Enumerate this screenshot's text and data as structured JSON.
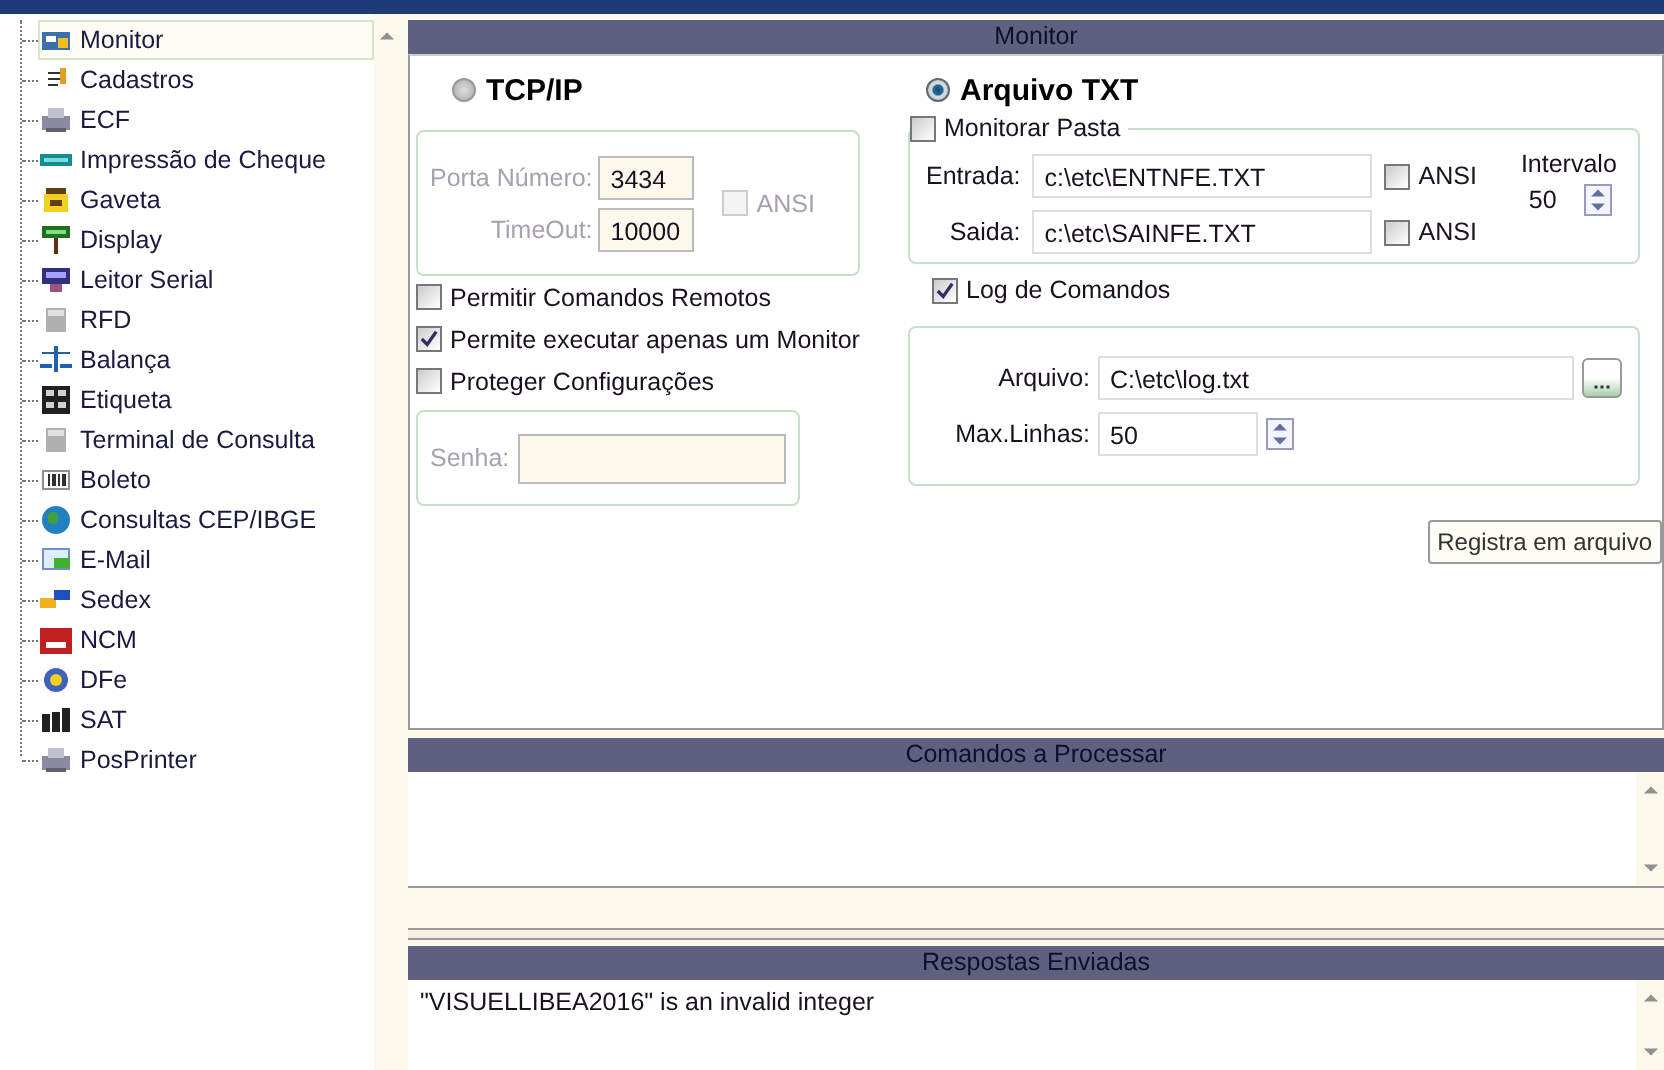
{
  "sidebar": {
    "items": [
      {
        "label": "Monitor",
        "selected": true
      },
      {
        "label": "Cadastros",
        "selected": false
      },
      {
        "label": "ECF",
        "selected": false
      },
      {
        "label": "Impressão de Cheque",
        "selected": false
      },
      {
        "label": "Gaveta",
        "selected": false
      },
      {
        "label": "Display",
        "selected": false
      },
      {
        "label": "Leitor Serial",
        "selected": false
      },
      {
        "label": "RFD",
        "selected": false
      },
      {
        "label": "Balança",
        "selected": false
      },
      {
        "label": "Etiqueta",
        "selected": false
      },
      {
        "label": "Terminal de Consulta",
        "selected": false
      },
      {
        "label": "Boleto",
        "selected": false
      },
      {
        "label": "Consultas CEP/IBGE",
        "selected": false
      },
      {
        "label": "E-Mail",
        "selected": false
      },
      {
        "label": "Sedex",
        "selected": false
      },
      {
        "label": "NCM",
        "selected": false
      },
      {
        "label": "DFe",
        "selected": false
      },
      {
        "label": "SAT",
        "selected": false
      },
      {
        "label": "PosPrinter",
        "selected": false
      }
    ]
  },
  "monitor": {
    "title": "Monitor",
    "modes": [
      {
        "label": "TCP/IP",
        "selected": false
      },
      {
        "label": "Arquivo TXT",
        "selected": true
      }
    ],
    "tcp": {
      "porta_label": "Porta Número:",
      "porta_value": "3434",
      "timeout_label": "TimeOut:",
      "timeout_value": "10000",
      "ansi": {
        "label": "ANSI",
        "checked": false
      }
    },
    "options": [
      {
        "label": "Permitir Comandos Remotos",
        "checked": false
      },
      {
        "label": "Permite executar apenas um Monitor",
        "checked": true
      },
      {
        "label": "Proteger Configurações",
        "checked": false
      }
    ],
    "senha": {
      "label": "Senha:"
    },
    "monitorar_pasta": {
      "label": "Monitorar Pasta",
      "checked": false
    },
    "entrada": {
      "label": "Entrada:",
      "value": "c:\\etc\\ENTNFE.TXT",
      "ansi": {
        "label": "ANSI",
        "checked": false
      }
    },
    "saida": {
      "label": "Saida:",
      "value": "c:\\etc\\SAINFE.TXT",
      "ansi": {
        "label": "ANSI",
        "checked": false
      }
    },
    "intervalo": {
      "label": "Intervalo",
      "value": "50"
    },
    "log": {
      "label": "Log de Comandos",
      "checked": true,
      "arquivo_label": "Arquivo:",
      "arquivo_value": "C:\\etc\\log.txt",
      "max_label": "Max.Linhas:",
      "max_value": "50"
    },
    "tooltip": "Registra em arquivo"
  },
  "comandos": {
    "title": "Comandos a Processar"
  },
  "respostas": {
    "title": "Respostas Enviadas",
    "lines": [
      "\"VISUELLIBEA2016\" is an invalid integer"
    ]
  }
}
